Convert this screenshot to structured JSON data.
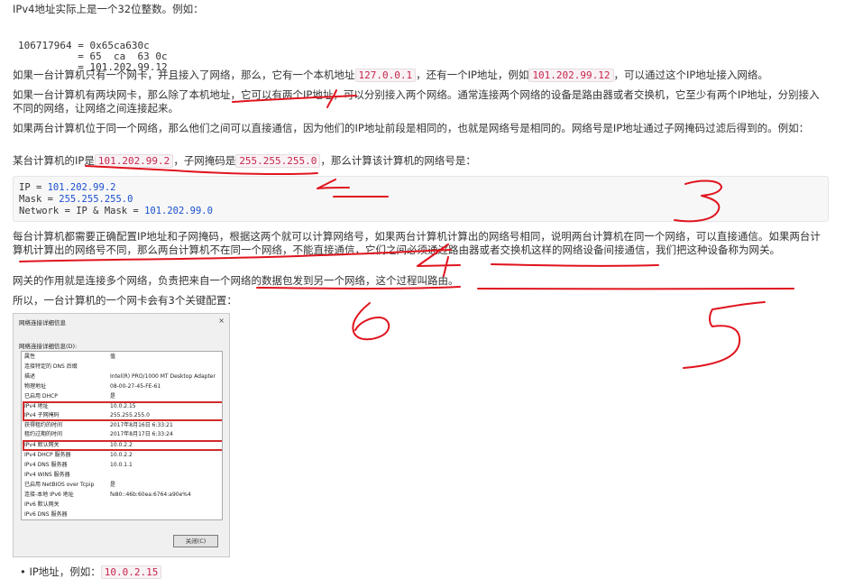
{
  "intro": "IPv4地址实际上是一个32位整数。例如：",
  "int_block": {
    "line1": "106717964 = 0x65ca630c",
    "line2": "          = 65  ca  63 0c",
    "line3": "          = 101.202.99.12"
  },
  "para1": {
    "a": "如果一台计算机只有一个网卡，并且接入了网络，那么，它有一个本机地址",
    "code1": "127.0.0.1",
    "b": "，还有一个IP地址，例如",
    "code2": "101.202.99.12",
    "c": "，可以通过这个IP地址接入网络。"
  },
  "para2": "如果一台计算机有两块网卡，那么除了本机地址，它可以有两个IP地址，可以分别接入两个网络。通常连接两个网络的设备是路由器或者交换机，它至少有两个IP地址，分别接入不同的网络，让网络之间连接起来。",
  "para3": "如果两台计算机位于同一个网络，那么他们之间可以直接通信，因为他们的IP地址前段是相同的，也就是网络号是相同的。网络号是IP地址通过子网掩码过滤后得到的。例如：",
  "para4": {
    "a": "某台计算机的IP是",
    "code1": "101.202.99.2",
    "b": "，子网掩码是",
    "code2": "255.255.255.0",
    "c": "，那么计算该计算机的网络号是："
  },
  "calc": {
    "l1_key": "IP = ",
    "l1_val": "101.202.99.2",
    "l2_key": "Mask = ",
    "l2_val": "255.255.255.0",
    "l3_key": "Network = IP & Mask = ",
    "l3_val": "101.202.99.0"
  },
  "para5": "每台计算机都需要正确配置IP地址和子网掩码，根据这两个就可以计算网络号，如果两台计算机计算出的网络号相同，说明两台计算机在同一个网络，可以直接通信。如果两台计算机计算出的网络号不同，那么两台计算机不在同一个网络，不能直接通信，它们之间必须通过路由器或者交换机这样的网络设备间接通信，我们把这种设备称为网关。",
  "para6": "网关的作用就是连接多个网络，负责把来自一个网络的数据包发到另一个网络，这个过程叫路由。",
  "para7": "所以，一台计算机的一个网卡会有3个关键配置：",
  "dialog": {
    "title": "网络连接详细信息",
    "close": "×",
    "subtitle": "网络连接详细信息(D):",
    "rows": [
      {
        "k": "属性",
        "v": "值"
      },
      {
        "k": "连接特定的 DNS 后缀",
        "v": ""
      },
      {
        "k": "描述",
        "v": "Intel(R) PRO/1000 MT Desktop Adapter"
      },
      {
        "k": "物理地址",
        "v": "08-00-27-45-FE-61"
      },
      {
        "k": "已启用 DHCP",
        "v": "是"
      },
      {
        "k": "IPv4 地址",
        "v": "10.0.2.15"
      },
      {
        "k": "IPv4 子网掩码",
        "v": "255.255.255.0"
      },
      {
        "k": "获得租约的时间",
        "v": "2017年8月16日 6:33:21"
      },
      {
        "k": "租约过期的时间",
        "v": "2017年8月17日 6:33:24"
      },
      {
        "k": "IPv4 默认网关",
        "v": "10.0.2.2"
      },
      {
        "k": "IPv4 DHCP 服务器",
        "v": "10.0.2.2"
      },
      {
        "k": "IPv4 DNS 服务器",
        "v": "10.0.1.1"
      },
      {
        "k": "IPv4 WINS 服务器",
        "v": ""
      },
      {
        "k": "已启用 NetBIOS over Tcpip",
        "v": "是"
      },
      {
        "k": "连接-本地 IPv6 地址",
        "v": "fe80::46b:60ea:6764:a90e%4"
      },
      {
        "k": "IPv6 默认网关",
        "v": ""
      },
      {
        "k": "IPv6 DNS 服务器",
        "v": ""
      }
    ],
    "close_button": "关闭(C)"
  },
  "bullet": {
    "a": "• IP地址，例如：",
    "code": "10.0.2.15"
  },
  "annotations": {
    "n1": "1",
    "n2": "2",
    "n3": "3",
    "n4": "4",
    "n5": "5",
    "n6": "6",
    "ink_color": "#e0141e"
  }
}
